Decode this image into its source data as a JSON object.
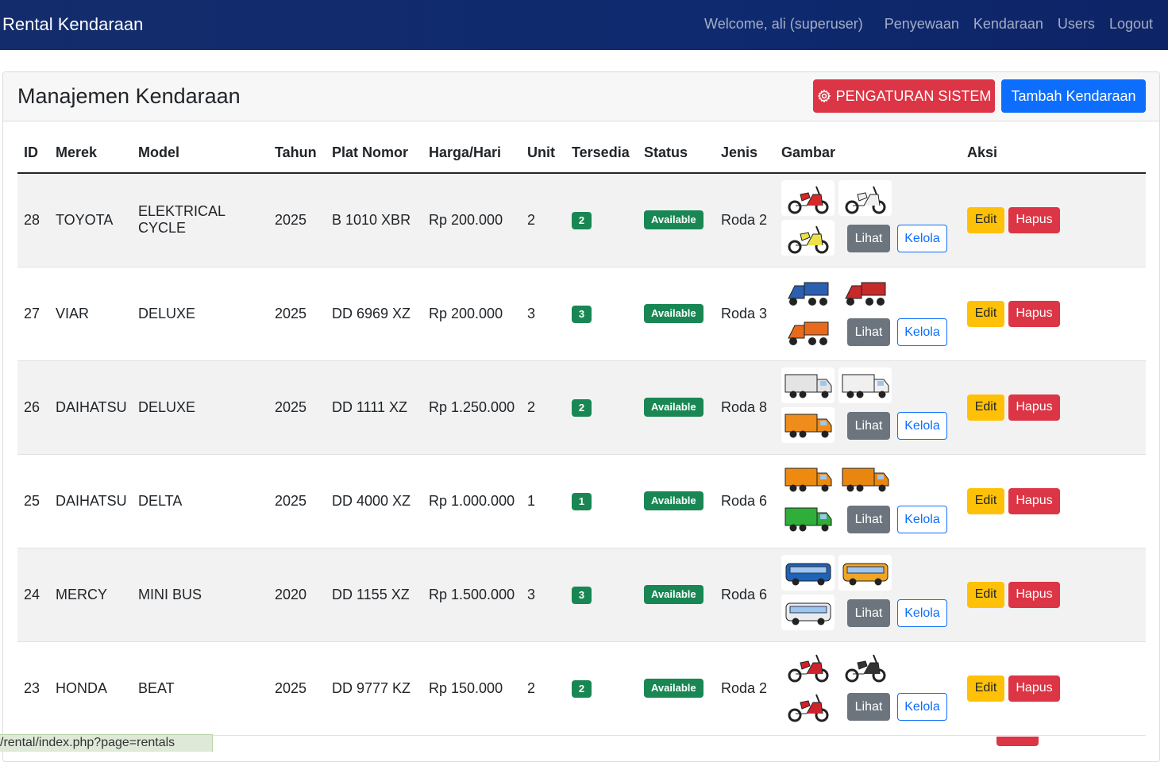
{
  "navbar": {
    "brand": "Rental Kendaraan",
    "welcome": "Welcome, ali (superuser)",
    "links": [
      "Penyewaan",
      "Kendaraan",
      "Users",
      "Logout"
    ]
  },
  "page": {
    "title": "Manajemen Kendaraan",
    "settings_button": "PENGATURAN SISTEM",
    "add_button": "Tambah Kendaraan"
  },
  "table": {
    "headers": [
      "ID",
      "Merek",
      "Model",
      "Tahun",
      "Plat Nomor",
      "Harga/Hari",
      "Unit",
      "Tersedia",
      "Status",
      "Jenis",
      "Gambar",
      "Aksi"
    ],
    "rows": [
      {
        "id": "28",
        "merek": "TOYOTA",
        "model": "ELEKTRICAL CYCLE",
        "tahun": "2025",
        "plat": "B 1010 XBR",
        "harga": "Rp 200.000",
        "unit": "2",
        "tersedia": "2",
        "status": "Available",
        "jenis": "Roda 2",
        "images": [
          "scooter-red",
          "scooter-white",
          "scooter-yellow"
        ]
      },
      {
        "id": "27",
        "merek": "VIAR",
        "model": "DELUXE",
        "tahun": "2025",
        "plat": "DD 6969 XZ",
        "harga": "Rp 200.000",
        "unit": "3",
        "tersedia": "3",
        "status": "Available",
        "jenis": "Roda 3",
        "images": [
          "tricycle-blue",
          "tricycle-red",
          "tricycle-orange"
        ]
      },
      {
        "id": "26",
        "merek": "DAIHATSU",
        "model": "DELUXE",
        "tahun": "2025",
        "plat": "DD 1111 XZ",
        "harga": "Rp 1.250.000",
        "unit": "2",
        "tersedia": "2",
        "status": "Available",
        "jenis": "Roda 8",
        "images": [
          "truck-box-white",
          "truck-white-front",
          "truck-orange-box"
        ]
      },
      {
        "id": "25",
        "merek": "DAIHATSU",
        "model": "DELTA",
        "tahun": "2025",
        "plat": "DD 4000 XZ",
        "harga": "Rp 1.000.000",
        "unit": "1",
        "tersedia": "1",
        "status": "Available",
        "jenis": "Roda 6",
        "images": [
          "truck-orange",
          "truck-orange-front",
          "truck-green"
        ]
      },
      {
        "id": "24",
        "merek": "MERCY",
        "model": "MINI BUS",
        "tahun": "2020",
        "plat": "DD 1155 XZ",
        "harga": "Rp 1.500.000",
        "unit": "3",
        "tersedia": "3",
        "status": "Available",
        "jenis": "Roda 6",
        "images": [
          "bus-blue",
          "minibus-yellow",
          "bus-white"
        ]
      },
      {
        "id": "23",
        "merek": "HONDA",
        "model": "BEAT",
        "tahun": "2025",
        "plat": "DD 9777 KZ",
        "harga": "Rp 150.000",
        "unit": "2",
        "tersedia": "2",
        "status": "Available",
        "jenis": "Roda 2",
        "images": [
          "motorbike-red",
          "motorbike-black",
          "motorbike-red-2"
        ]
      }
    ],
    "lihat_label": "Lihat",
    "kelola_label": "Kelola",
    "edit_label": "Edit",
    "hapus_label": "Hapus"
  },
  "status_bar": "/rental/index.php?page=rentals",
  "colors": {
    "navbar": "#132c6b",
    "danger": "#dc3545",
    "primary": "#0d6efd",
    "success": "#198754",
    "warning": "#ffc107",
    "secondary": "#6c757d"
  }
}
